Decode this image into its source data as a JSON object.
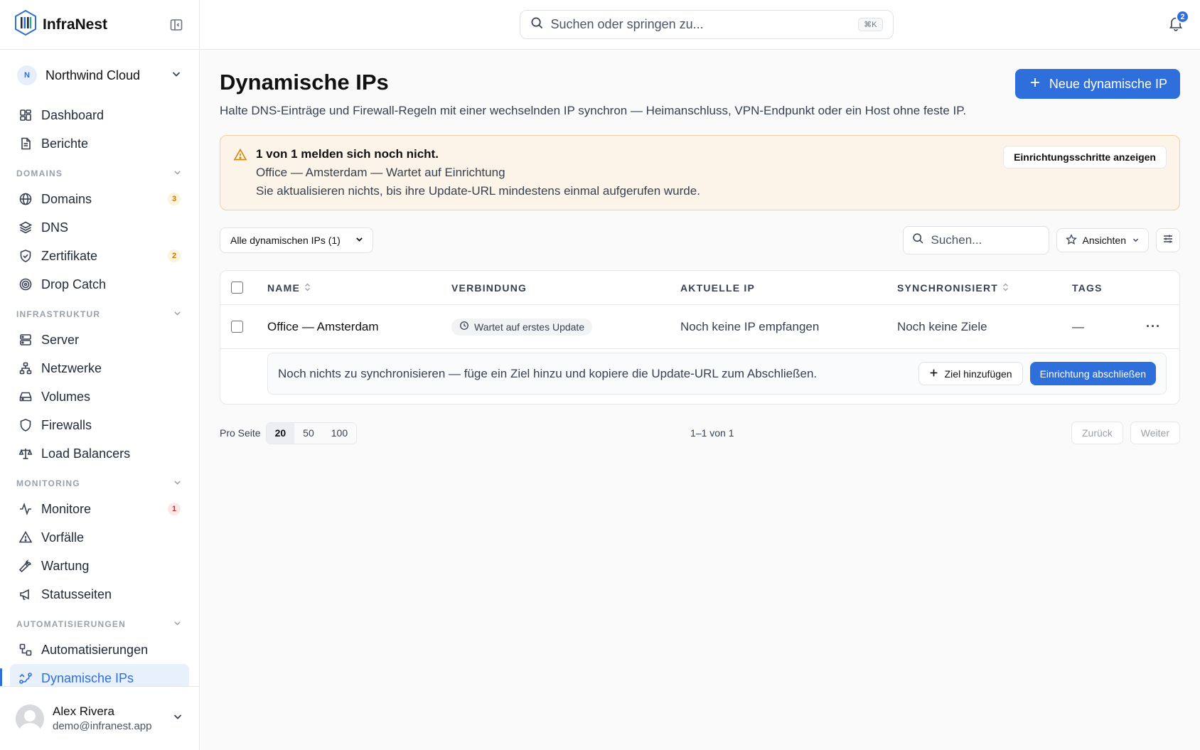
{
  "app": {
    "name": "InfraNest"
  },
  "org": {
    "initial": "N",
    "name": "Northwind Cloud"
  },
  "nav": {
    "top": [
      {
        "label": "Dashboard",
        "icon": "dashboard-icon"
      },
      {
        "label": "Berichte",
        "icon": "report-icon"
      }
    ],
    "sections": [
      {
        "title": "DOMAINS",
        "items": [
          {
            "label": "Domains",
            "badge": "3",
            "badge_color": "amber"
          },
          {
            "label": "DNS"
          },
          {
            "label": "Zertifikate",
            "badge": "2",
            "badge_color": "amber"
          },
          {
            "label": "Drop Catch"
          }
        ]
      },
      {
        "title": "INFRASTRUKTUR",
        "items": [
          {
            "label": "Server"
          },
          {
            "label": "Netzwerke"
          },
          {
            "label": "Volumes"
          },
          {
            "label": "Firewalls"
          },
          {
            "label": "Load Balancers"
          }
        ]
      },
      {
        "title": "MONITORING",
        "items": [
          {
            "label": "Monitore",
            "badge": "1",
            "badge_color": "red"
          },
          {
            "label": "Vorfälle"
          },
          {
            "label": "Wartung"
          },
          {
            "label": "Statusseiten"
          }
        ]
      },
      {
        "title": "AUTOMATISIERUNGEN",
        "items": [
          {
            "label": "Automatisierungen"
          },
          {
            "label": "Dynamische IPs",
            "active": true
          }
        ]
      }
    ]
  },
  "user": {
    "name": "Alex Rivera",
    "email": "demo@infranest.app"
  },
  "topbar": {
    "search_placeholder": "Suchen oder springen zu...",
    "shortcut": "⌘K",
    "notification_count": "2"
  },
  "page": {
    "title": "Dynamische IPs",
    "subtitle": "Halte DNS-Einträge und Firewall-Regeln mit einer wechselnden IP synchron — Heimanschluss, VPN-Endpunkt oder ein Host ohne feste IP.",
    "new_button": "Neue dynamische IP"
  },
  "alert": {
    "title": "1 von 1 melden sich noch nicht.",
    "line1": "Office — Amsterdam — Wartet auf Einrichtung",
    "line2": "Sie aktualisieren nichts, bis ihre Update-URL mindestens einmal aufgerufen wurde.",
    "button": "Einrichtungsschritte anzeigen"
  },
  "toolbar": {
    "filter": "Alle dynamischen IPs (1)",
    "search_placeholder": "Suchen...",
    "views": "Ansichten"
  },
  "table": {
    "headers": {
      "name": "NAME",
      "connection": "VERBINDUNG",
      "current_ip": "AKTUELLE IP",
      "synced": "SYNCHRONISIERT",
      "tags": "TAGS"
    },
    "rows": [
      {
        "name": "Office — Amsterdam",
        "status": "Wartet auf erstes Update",
        "current_ip": "Noch keine IP empfangen",
        "synced": "Noch keine Ziele",
        "tags": "—"
      }
    ],
    "setup_hint": "Noch nichts zu synchronisieren — füge ein Ziel hinzu und kopiere die Update-URL zum Abschließen.",
    "add_target": "Ziel hinzufügen",
    "finish_setup": "Einrichtung abschließen"
  },
  "pagination": {
    "per_page_label": "Pro Seite",
    "options": [
      "20",
      "50",
      "100"
    ],
    "selected": "20",
    "range": "1–1 von 1",
    "prev": "Zurück",
    "next": "Weiter"
  },
  "colors": {
    "accent": "#2f6fdc",
    "warning_bg": "#fcf4e8",
    "warning_border": "#f0cfa0"
  }
}
